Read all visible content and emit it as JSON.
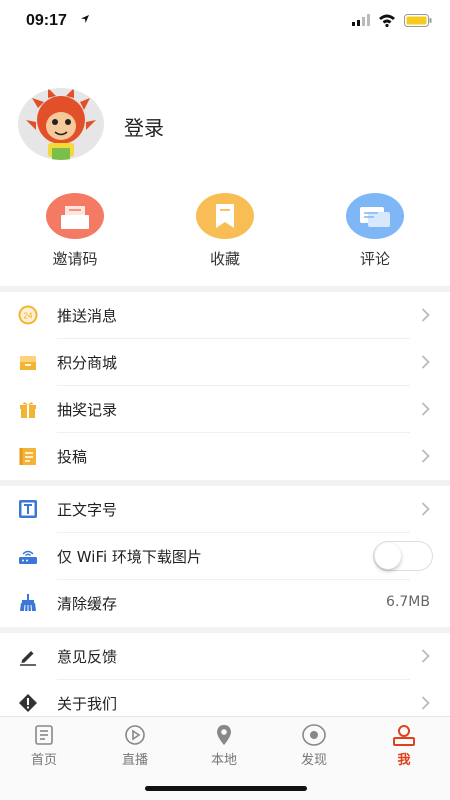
{
  "status_bar": {
    "time": "09:17"
  },
  "profile": {
    "login_label": "登录"
  },
  "shortcuts": [
    {
      "label": "邀请码",
      "icon": "envelope-icon",
      "color": "#f47a64"
    },
    {
      "label": "收藏",
      "icon": "bookmark-icon",
      "color": "#f8bd54"
    },
    {
      "label": "评论",
      "icon": "comment-icon",
      "color": "#7fb6f6"
    }
  ],
  "menu_group_1": [
    {
      "label": "推送消息",
      "icon": "push-badge-icon",
      "badge": "24"
    },
    {
      "label": "积分商城",
      "icon": "store-box-icon"
    },
    {
      "label": "抽奖记录",
      "icon": "gift-icon"
    },
    {
      "label": "投稿",
      "icon": "notebook-icon"
    }
  ],
  "menu_group_2": [
    {
      "label": "正文字号",
      "icon": "font-size-icon"
    },
    {
      "label": "仅 WiFi 环境下载图片",
      "icon": "router-icon",
      "toggle": false
    },
    {
      "label": "清除缓存",
      "icon": "broom-icon",
      "value": "6.7MB"
    }
  ],
  "menu_group_3": [
    {
      "label": "意见反馈",
      "icon": "pencil-icon"
    },
    {
      "label": "关于我们",
      "icon": "info-diamond-icon"
    }
  ],
  "tab_bar": [
    {
      "label": "首页",
      "icon": "news-icon",
      "active": false
    },
    {
      "label": "直播",
      "icon": "play-icon",
      "active": false
    },
    {
      "label": "本地",
      "icon": "location-pin-icon",
      "active": false
    },
    {
      "label": "发现",
      "icon": "discover-icon",
      "active": false
    },
    {
      "label": "我",
      "icon": "profile-icon",
      "active": true
    }
  ],
  "colors": {
    "accent": "#e0401c",
    "icon_orange": "#f5b335",
    "icon_blue": "#3a78d8"
  }
}
